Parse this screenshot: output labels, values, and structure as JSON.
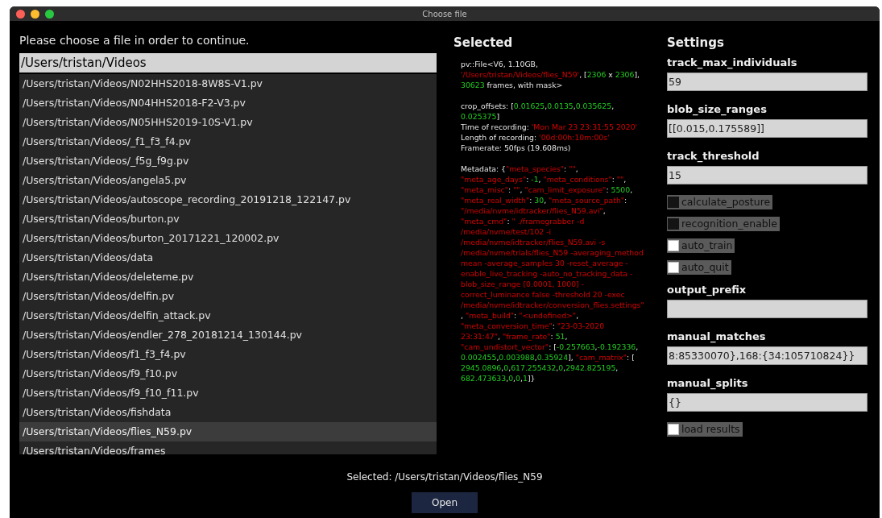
{
  "window": {
    "title": "Choose file"
  },
  "prompt": "Please choose a file in order to continue.",
  "path_field": {
    "value": "/Users/tristan/Videos"
  },
  "files": [
    {
      "label": "/Users/tristan/Videos/N02HHS2018-8W8S-V1.pv",
      "selected": false
    },
    {
      "label": "/Users/tristan/Videos/N04HHS2018-F2-V3.pv",
      "selected": false
    },
    {
      "label": "/Users/tristan/Videos/N05HHS2019-10S-V1.pv",
      "selected": false
    },
    {
      "label": "/Users/tristan/Videos/_f1_f3_f4.pv",
      "selected": false
    },
    {
      "label": "/Users/tristan/Videos/_f5g_f9g.pv",
      "selected": false
    },
    {
      "label": "/Users/tristan/Videos/angela5.pv",
      "selected": false
    },
    {
      "label": "/Users/tristan/Videos/autoscope_recording_20191218_122147.pv",
      "selected": false
    },
    {
      "label": "/Users/tristan/Videos/burton.pv",
      "selected": false
    },
    {
      "label": "/Users/tristan/Videos/burton_20171221_120002.pv",
      "selected": false
    },
    {
      "label": "/Users/tristan/Videos/data",
      "selected": false
    },
    {
      "label": "/Users/tristan/Videos/deleteme.pv",
      "selected": false
    },
    {
      "label": "/Users/tristan/Videos/delfin.pv",
      "selected": false
    },
    {
      "label": "/Users/tristan/Videos/delfin_attack.pv",
      "selected": false
    },
    {
      "label": "/Users/tristan/Videos/endler_278_20181214_130144.pv",
      "selected": false
    },
    {
      "label": "/Users/tristan/Videos/f1_f3_f4.pv",
      "selected": false
    },
    {
      "label": "/Users/tristan/Videos/f9_f10.pv",
      "selected": false
    },
    {
      "label": "/Users/tristan/Videos/f9_f10_f11.pv",
      "selected": false
    },
    {
      "label": "/Users/tristan/Videos/fishdata",
      "selected": false
    },
    {
      "label": "/Users/tristan/Videos/flies_N59.pv",
      "selected": true
    },
    {
      "label": "/Users/tristan/Videos/frames",
      "selected": false
    }
  ],
  "selected_panel": {
    "title": "Selected",
    "blocks": [
      [
        [
          {
            "text": "pv::File<V6, 1.10GB, ",
            "kind": "text"
          },
          {
            "text": "'/Users/tristan/Videos/flies_N59'",
            "kind": "string"
          },
          {
            "text": ", [",
            "kind": "text"
          },
          {
            "text": "2306",
            "kind": "number"
          },
          {
            "text": " x ",
            "kind": "text"
          },
          {
            "text": "2306",
            "kind": "number"
          },
          {
            "text": "], ",
            "kind": "text"
          },
          {
            "text": "30623",
            "kind": "number"
          },
          {
            "text": " frames, with mask>",
            "kind": "text"
          }
        ]
      ],
      [
        [
          {
            "text": "crop_offsets: [",
            "kind": "text"
          },
          {
            "text": "0.01625",
            "kind": "number"
          },
          {
            "text": ",",
            "kind": "text"
          },
          {
            "text": "0.0135",
            "kind": "number"
          },
          {
            "text": ",",
            "kind": "text"
          },
          {
            "text": "0.035625",
            "kind": "number"
          },
          {
            "text": ", ",
            "kind": "text"
          },
          {
            "text": "0.025375",
            "kind": "number"
          },
          {
            "text": "]",
            "kind": "text"
          }
        ],
        [
          {
            "text": "Time of recording: ",
            "kind": "text"
          },
          {
            "text": "'Mon Mar 23 23:31:55 2020'",
            "kind": "string"
          }
        ],
        [
          {
            "text": "Length of recording: ",
            "kind": "text"
          },
          {
            "text": "'00d:00h:10m:00s'",
            "kind": "string"
          }
        ],
        [
          {
            "text": "Framerate: 50fps (19.608ms)",
            "kind": "text"
          }
        ]
      ],
      [
        [
          {
            "text": "Metadata: {",
            "kind": "text"
          },
          {
            "text": "\"meta_species\"",
            "kind": "string"
          },
          {
            "text": ": ",
            "kind": "text"
          },
          {
            "text": "\"\"",
            "kind": "string"
          },
          {
            "text": ", ",
            "kind": "text"
          },
          {
            "text": "\"meta_age_days\"",
            "kind": "string"
          },
          {
            "text": ": ",
            "kind": "text"
          },
          {
            "text": "-1",
            "kind": "number"
          },
          {
            "text": ", ",
            "kind": "text"
          },
          {
            "text": "\"meta_conditions\"",
            "kind": "string"
          },
          {
            "text": ": ",
            "kind": "text"
          },
          {
            "text": "\"\"",
            "kind": "string"
          },
          {
            "text": ", ",
            "kind": "text"
          },
          {
            "text": "\"meta_misc\"",
            "kind": "string"
          },
          {
            "text": ": ",
            "kind": "text"
          },
          {
            "text": "\"\"",
            "kind": "string"
          },
          {
            "text": ", ",
            "kind": "text"
          },
          {
            "text": "\"cam_limit_exposure\"",
            "kind": "string"
          },
          {
            "text": ": ",
            "kind": "text"
          },
          {
            "text": "5500",
            "kind": "number"
          },
          {
            "text": ", ",
            "kind": "text"
          },
          {
            "text": "\"meta_real_width\"",
            "kind": "string"
          },
          {
            "text": ": ",
            "kind": "text"
          },
          {
            "text": "30",
            "kind": "number"
          },
          {
            "text": ", ",
            "kind": "text"
          },
          {
            "text": "\"meta_source_path\"",
            "kind": "string"
          },
          {
            "text": ": ",
            "kind": "text"
          },
          {
            "text": "\"/media/nvme/idtracker/flies_N59.avi\"",
            "kind": "string"
          },
          {
            "text": ", ",
            "kind": "text"
          },
          {
            "text": "\"meta_cmd\"",
            "kind": "string"
          },
          {
            "text": ": ",
            "kind": "text"
          },
          {
            "text": "\" ./framegrabber -d /media/nvme/test/102 -i /media/nvme/idtracker/flies_N59.avi -s /media/nvme/trials/flies_N59 -averaging_method mean -average_samples 30 -reset_average -enable_live_tracking -auto_no_tracking_data -blob_size_range [0.0001, 1000] -correct_luminance false -threshold 20 -exec /media/nvme/idtracker/conversion_flies.settings\"",
            "kind": "string"
          },
          {
            "text": ", ",
            "kind": "text"
          },
          {
            "text": "\"meta_build\"",
            "kind": "string"
          },
          {
            "text": ": ",
            "kind": "text"
          },
          {
            "text": "\"<undefined>\"",
            "kind": "string"
          },
          {
            "text": ", ",
            "kind": "text"
          },
          {
            "text": "\"meta_conversion_time\"",
            "kind": "string"
          },
          {
            "text": ": ",
            "kind": "text"
          },
          {
            "text": "\"23-03-2020 23:31:47\"",
            "kind": "string"
          },
          {
            "text": ", ",
            "kind": "text"
          },
          {
            "text": "\"frame_rate\"",
            "kind": "string"
          },
          {
            "text": ": ",
            "kind": "text"
          },
          {
            "text": "51",
            "kind": "number"
          },
          {
            "text": ", ",
            "kind": "text"
          },
          {
            "text": "\"cam_undistort_vector\"",
            "kind": "string"
          },
          {
            "text": ": [",
            "kind": "text"
          },
          {
            "text": "-0.257663",
            "kind": "number"
          },
          {
            "text": ",",
            "kind": "text"
          },
          {
            "text": "-0.192336",
            "kind": "number"
          },
          {
            "text": ", ",
            "kind": "text"
          },
          {
            "text": "0.002455",
            "kind": "number"
          },
          {
            "text": ",",
            "kind": "text"
          },
          {
            "text": "0.003988",
            "kind": "number"
          },
          {
            "text": ",",
            "kind": "text"
          },
          {
            "text": "0.35924",
            "kind": "number"
          },
          {
            "text": "], ",
            "kind": "text"
          },
          {
            "text": "\"cam_matrix\"",
            "kind": "string"
          },
          {
            "text": ": [ ",
            "kind": "text"
          },
          {
            "text": "2945.0896",
            "kind": "number"
          },
          {
            "text": ",",
            "kind": "text"
          },
          {
            "text": "0",
            "kind": "number"
          },
          {
            "text": ",",
            "kind": "text"
          },
          {
            "text": "617.255432",
            "kind": "number"
          },
          {
            "text": ",",
            "kind": "text"
          },
          {
            "text": "0",
            "kind": "number"
          },
          {
            "text": ",",
            "kind": "text"
          },
          {
            "text": "2942.825195",
            "kind": "number"
          },
          {
            "text": ", ",
            "kind": "text"
          },
          {
            "text": "682.473633",
            "kind": "number"
          },
          {
            "text": ",",
            "kind": "text"
          },
          {
            "text": "0",
            "kind": "number"
          },
          {
            "text": ",",
            "kind": "text"
          },
          {
            "text": "0",
            "kind": "number"
          },
          {
            "text": ",",
            "kind": "text"
          },
          {
            "text": "1",
            "kind": "number"
          },
          {
            "text": "]}",
            "kind": "text"
          }
        ]
      ]
    ]
  },
  "settings": {
    "title": "Settings",
    "items": [
      {
        "kind": "field",
        "label": "track_max_individuals",
        "value": "59"
      },
      {
        "kind": "field",
        "label": "blob_size_ranges",
        "value": "[[0.015,0.175589]]"
      },
      {
        "kind": "field",
        "label": "track_threshold",
        "value": "15"
      },
      {
        "kind": "checkbox",
        "label": "calculate_posture",
        "checked": true
      },
      {
        "kind": "checkbox",
        "label": "recognition_enable",
        "checked": true
      },
      {
        "kind": "checkbox",
        "label": "auto_train",
        "checked": false
      },
      {
        "kind": "checkbox",
        "label": "auto_quit",
        "checked": false
      },
      {
        "kind": "field",
        "label": "output_prefix"
      },
      {
        "kind": "field",
        "label": "manual_matches",
        "value": "8:85330070},168:{34:105710824}}"
      },
      {
        "kind": "field",
        "label": "manual_splits",
        "value": "{}"
      },
      {
        "kind": "checkbox",
        "label": "load results",
        "checked": false
      }
    ]
  },
  "status": "Selected: /Users/tristan/Videos/flies_N59",
  "buttons": [
    "Open"
  ]
}
